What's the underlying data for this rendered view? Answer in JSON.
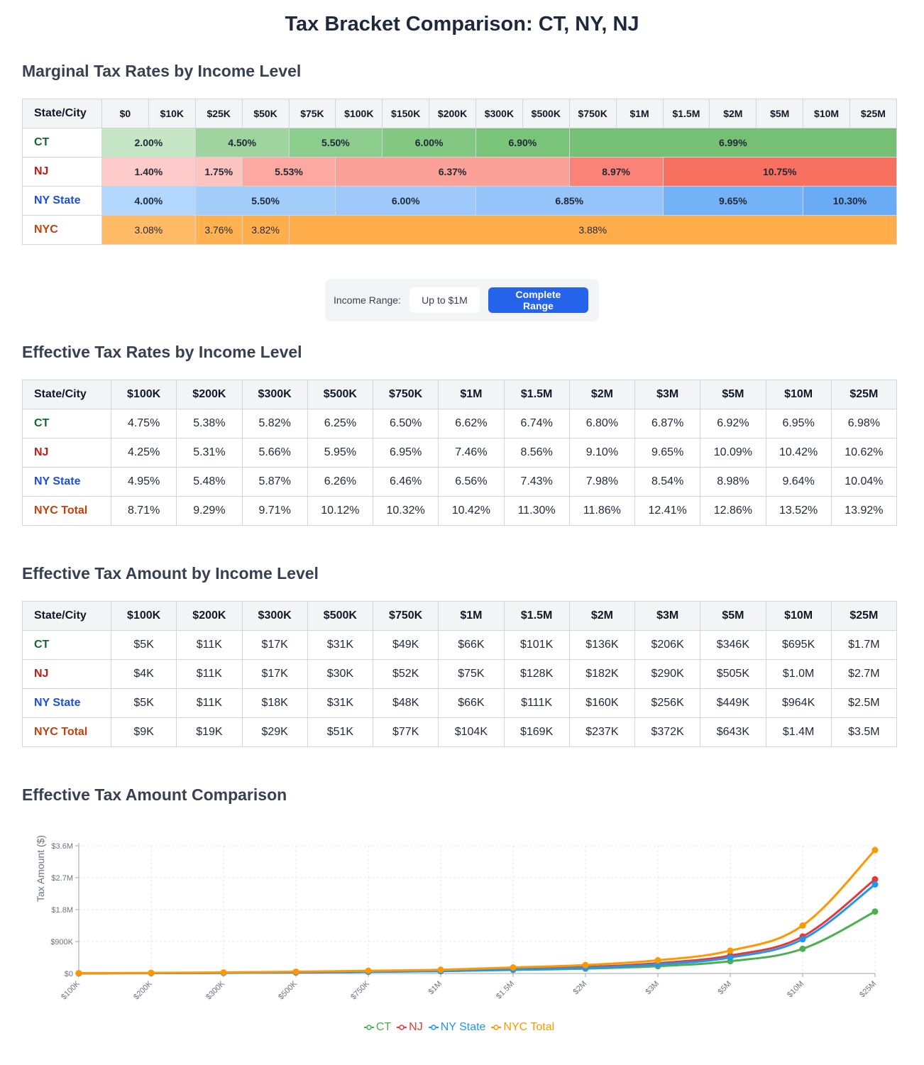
{
  "title": "Tax Bracket Comparison: CT, NY, NJ",
  "colors": {
    "ct": "#166534",
    "nj": "#b91c1c",
    "ny": "#1d4ed8",
    "nyc": "#c2410c",
    "line_ct": "#4caf50",
    "line_nj": "#e53935",
    "line_ny": "#2196f3",
    "line_nyc": "#ff9800"
  },
  "marginal": {
    "heading": "Marginal Tax Rates by Income Level",
    "header_state": "State/City",
    "thresholds": [
      "$0",
      "$10K",
      "$25K",
      "$50K",
      "$75K",
      "$100K",
      "$150K",
      "$200K",
      "$300K",
      "$500K",
      "$750K",
      "$1M",
      "$1.5M",
      "$2M",
      "$5M",
      "$10M",
      "$25M"
    ],
    "rows": [
      {
        "state": "CT",
        "key": "ct",
        "bands": [
          {
            "label": "2.00%",
            "span": 2,
            "color": "#c6e6c6"
          },
          {
            "label": "4.50%",
            "span": 2,
            "color": "#9fd49f"
          },
          {
            "label": "5.50%",
            "span": 2,
            "color": "#8ccc8c"
          },
          {
            "label": "6.00%",
            "span": 2,
            "color": "#82c882"
          },
          {
            "label": "6.90%",
            "span": 2,
            "color": "#7ac47a"
          },
          {
            "label": "6.99%",
            "span": 7,
            "color": "#76c076"
          }
        ]
      },
      {
        "state": "NJ",
        "key": "nj",
        "bands": [
          {
            "label": "1.40%",
            "span": 2,
            "color": "#fecaca"
          },
          {
            "label": "1.75%",
            "span": 1,
            "color": "#fec4c0"
          },
          {
            "label": "5.53%",
            "span": 2,
            "color": "#fda8a0"
          },
          {
            "label": "6.37%",
            "span": 5,
            "color": "#fca198"
          },
          {
            "label": "8.97%",
            "span": 2,
            "color": "#fb8277"
          },
          {
            "label": "10.75%",
            "span": 5,
            "color": "#f87060"
          }
        ]
      },
      {
        "state": "NY State",
        "key": "ny",
        "bands": [
          {
            "label": "4.00%",
            "span": 2,
            "color": "#b3d7fc"
          },
          {
            "label": "5.50%",
            "span": 3,
            "color": "#a3cdfb"
          },
          {
            "label": "6.00%",
            "span": 3,
            "color": "#9ec9fa"
          },
          {
            "label": "6.85%",
            "span": 4,
            "color": "#94c4f9"
          },
          {
            "label": "9.65%",
            "span": 3,
            "color": "#74b2f7"
          },
          {
            "label": "10.30%",
            "span": 2,
            "color": "#6aabf5"
          }
        ]
      },
      {
        "state": "NYC",
        "key": "nyc",
        "bands": [
          {
            "label": "3.08%",
            "span": 2,
            "color": "#ffbb66"
          },
          {
            "label": "3.76%",
            "span": 1,
            "color": "#ffb04f"
          },
          {
            "label": "3.82%",
            "span": 1,
            "color": "#ffae4c"
          },
          {
            "label": "3.88%",
            "span": 13,
            "color": "#ffac4a"
          }
        ]
      }
    ]
  },
  "toggle": {
    "label": "Income Range:",
    "option_1": "Up to $1M",
    "option_2": "Complete Range",
    "selected": "Complete Range"
  },
  "effective_rates": {
    "heading": "Effective Tax Rates by Income Level",
    "header_state": "State/City",
    "incomes": [
      "$100K",
      "$200K",
      "$300K",
      "$500K",
      "$750K",
      "$1M",
      "$1.5M",
      "$2M",
      "$3M",
      "$5M",
      "$10M",
      "$25M"
    ],
    "rows": [
      {
        "state": "CT",
        "key": "ct",
        "values": [
          "4.75%",
          "5.38%",
          "5.82%",
          "6.25%",
          "6.50%",
          "6.62%",
          "6.74%",
          "6.80%",
          "6.87%",
          "6.92%",
          "6.95%",
          "6.98%"
        ]
      },
      {
        "state": "NJ",
        "key": "nj",
        "values": [
          "4.25%",
          "5.31%",
          "5.66%",
          "5.95%",
          "6.95%",
          "7.46%",
          "8.56%",
          "9.10%",
          "9.65%",
          "10.09%",
          "10.42%",
          "10.62%"
        ]
      },
      {
        "state": "NY State",
        "key": "ny",
        "values": [
          "4.95%",
          "5.48%",
          "5.87%",
          "6.26%",
          "6.46%",
          "6.56%",
          "7.43%",
          "7.98%",
          "8.54%",
          "8.98%",
          "9.64%",
          "10.04%"
        ]
      },
      {
        "state": "NYC Total",
        "key": "nyc",
        "values": [
          "8.71%",
          "9.29%",
          "9.71%",
          "10.12%",
          "10.32%",
          "10.42%",
          "11.30%",
          "11.86%",
          "12.41%",
          "12.86%",
          "13.52%",
          "13.92%"
        ]
      }
    ]
  },
  "effective_amounts": {
    "heading": "Effective Tax Amount by Income Level",
    "header_state": "State/City",
    "incomes": [
      "$100K",
      "$200K",
      "$300K",
      "$500K",
      "$750K",
      "$1M",
      "$1.5M",
      "$2M",
      "$3M",
      "$5M",
      "$10M",
      "$25M"
    ],
    "rows": [
      {
        "state": "CT",
        "key": "ct",
        "values": [
          "$5K",
          "$11K",
          "$17K",
          "$31K",
          "$49K",
          "$66K",
          "$101K",
          "$136K",
          "$206K",
          "$346K",
          "$695K",
          "$1.7M"
        ]
      },
      {
        "state": "NJ",
        "key": "nj",
        "values": [
          "$4K",
          "$11K",
          "$17K",
          "$30K",
          "$52K",
          "$75K",
          "$128K",
          "$182K",
          "$290K",
          "$505K",
          "$1.0M",
          "$2.7M"
        ]
      },
      {
        "state": "NY State",
        "key": "ny",
        "values": [
          "$5K",
          "$11K",
          "$18K",
          "$31K",
          "$48K",
          "$66K",
          "$111K",
          "$160K",
          "$256K",
          "$449K",
          "$964K",
          "$2.5M"
        ]
      },
      {
        "state": "NYC Total",
        "key": "nyc",
        "values": [
          "$9K",
          "$19K",
          "$29K",
          "$51K",
          "$77K",
          "$104K",
          "$169K",
          "$237K",
          "$372K",
          "$643K",
          "$1.4M",
          "$3.5M"
        ]
      }
    ]
  },
  "chart_data": {
    "type": "line",
    "title": "Effective Tax Amount Comparison",
    "xlabel": "",
    "ylabel": "Tax Amount ($)",
    "categories": [
      "$100K",
      "$200K",
      "$300K",
      "$500K",
      "$750K",
      "$1M",
      "$1.5M",
      "$2M",
      "$3M",
      "$5M",
      "$10M",
      "$25M"
    ],
    "y_ticks": [
      "$0",
      "$900K",
      "$1.8M",
      "$2.7M",
      "$3.6M"
    ],
    "ylim": [
      0,
      3600000
    ],
    "grid": true,
    "legend_position": "bottom",
    "series": [
      {
        "name": "CT",
        "color": "#4caf50",
        "values": [
          4750,
          10760,
          17460,
          31250,
          48750,
          66200,
          101100,
          136000,
          206100,
          346000,
          695000,
          1745000
        ]
      },
      {
        "name": "NJ",
        "color": "#e53935",
        "values": [
          4250,
          10620,
          16980,
          29750,
          52125,
          74600,
          128400,
          182000,
          289500,
          504500,
          1042000,
          2655000
        ]
      },
      {
        "name": "NY State",
        "color": "#2196f3",
        "values": [
          4950,
          10960,
          17610,
          31300,
          48450,
          65600,
          111450,
          159600,
          256200,
          449000,
          964000,
          2510000
        ]
      },
      {
        "name": "NYC Total",
        "color": "#ff9800",
        "values": [
          8710,
          18580,
          29130,
          50600,
          77400,
          104200,
          169500,
          237200,
          372300,
          643000,
          1352000,
          3480000
        ]
      }
    ]
  }
}
